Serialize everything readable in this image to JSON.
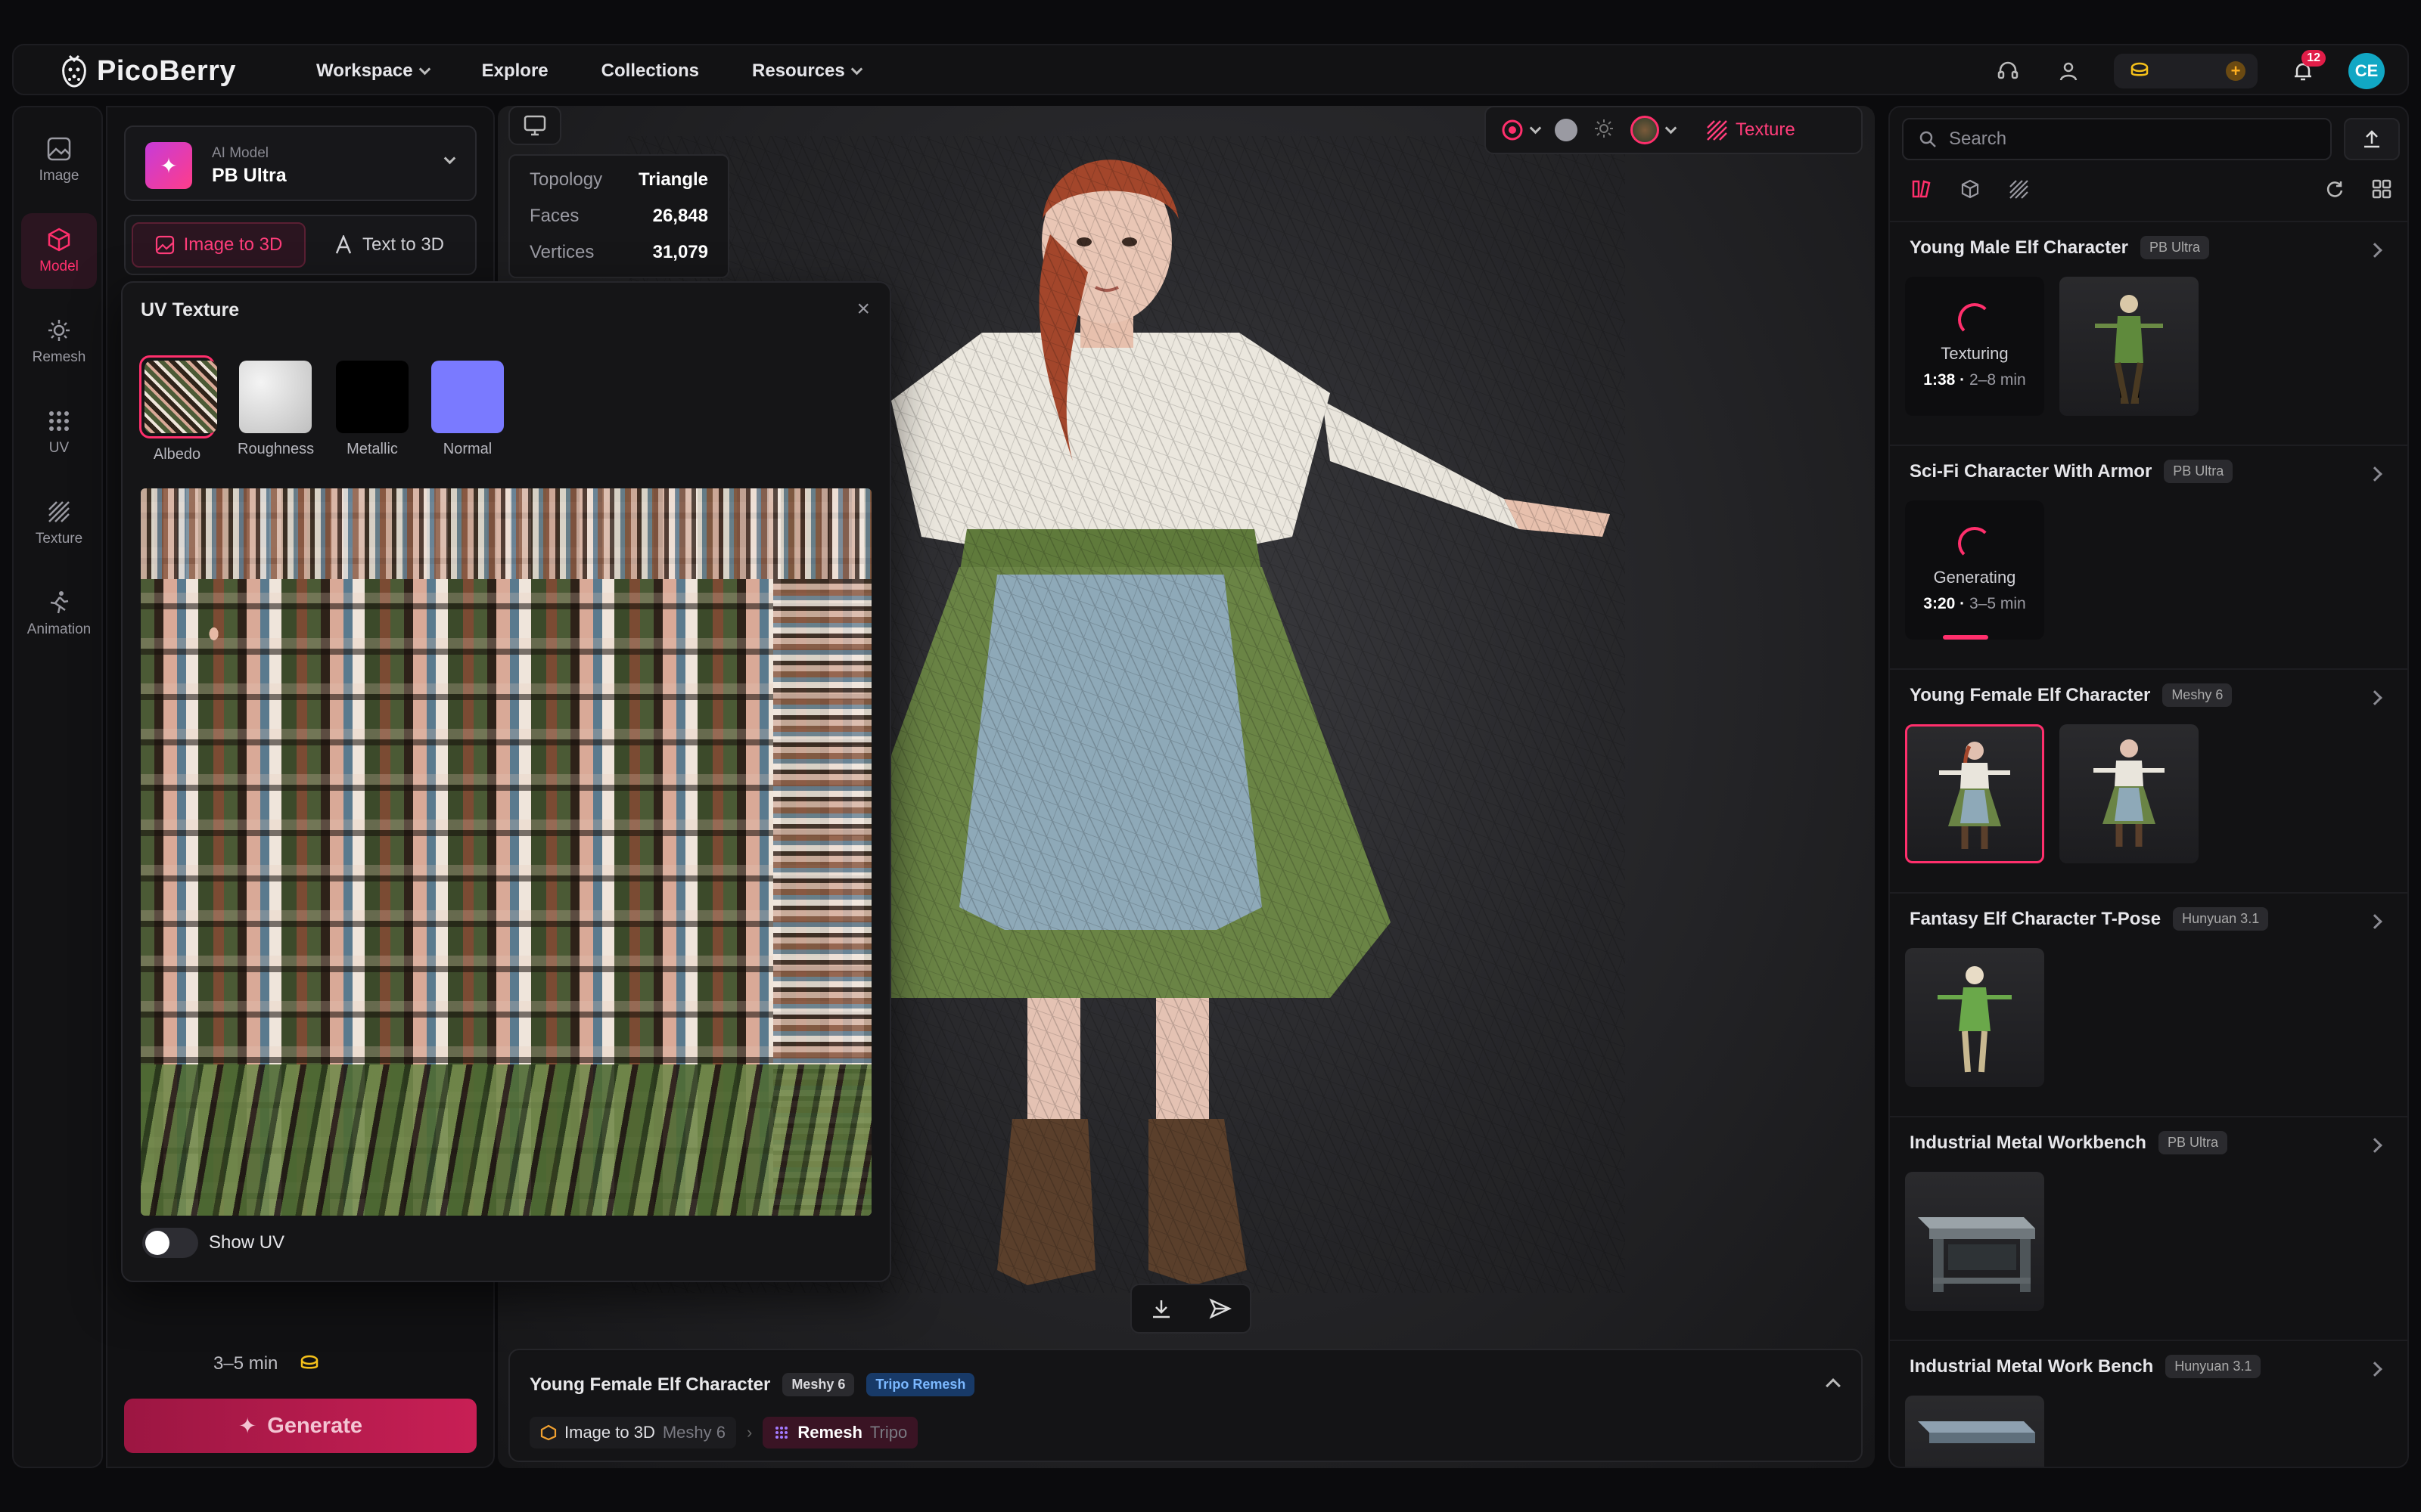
{
  "brand": {
    "name": "PicoBerry"
  },
  "nav": {
    "items": [
      {
        "label": "Workspace",
        "dropdown": true
      },
      {
        "label": "Explore",
        "dropdown": false
      },
      {
        "label": "Collections",
        "dropdown": false
      },
      {
        "label": "Resources",
        "dropdown": true
      }
    ]
  },
  "header": {
    "notification_count": "12",
    "avatar_initials": "CE",
    "icons": [
      "headset-icon",
      "user-icon",
      "coin-icon",
      "plus-icon",
      "bell-icon"
    ]
  },
  "rail": {
    "items": [
      {
        "label": "Image",
        "icon": "image-icon",
        "active": false
      },
      {
        "label": "Model",
        "icon": "cube-icon",
        "active": true
      },
      {
        "label": "Remesh",
        "icon": "remesh-icon",
        "active": false
      },
      {
        "label": "UV",
        "icon": "grid-dots-icon",
        "active": false
      },
      {
        "label": "Texture",
        "icon": "hatch-icon",
        "active": false
      },
      {
        "label": "Animation",
        "icon": "running-icon",
        "active": false
      }
    ]
  },
  "left_panel": {
    "model_caption": "AI Model",
    "model_name": "PB Ultra",
    "tabs": [
      {
        "label": "Image to 3D",
        "active": true
      },
      {
        "label": "Text to 3D",
        "active": false
      }
    ],
    "time_estimate": "3–5 min",
    "generate_label": "Generate"
  },
  "uv_panel": {
    "title": "UV Texture",
    "swatches": [
      {
        "label": "Albedo",
        "color": "#5b5a3c",
        "active": true
      },
      {
        "label": "Roughness",
        "color": "#d9d9d9",
        "active": false
      },
      {
        "label": "Metallic",
        "color": "#000000",
        "active": false
      },
      {
        "label": "Normal",
        "color": "#7a7aff",
        "active": false
      }
    ],
    "show_uv_label": "Show UV",
    "show_uv_on": false
  },
  "viewport": {
    "stats": [
      {
        "key": "Topology",
        "value": "Triangle"
      },
      {
        "key": "Faces",
        "value": "26,848"
      },
      {
        "key": "Vertices",
        "value": "31,079"
      }
    ],
    "texture_label": "Texture",
    "info": {
      "title": "Young Female Elf Character",
      "tags": [
        {
          "label": "Meshy 6",
          "style": "grey"
        },
        {
          "label": "Tripo Remesh",
          "style": "blue"
        }
      ],
      "steps": [
        {
          "label": "Image to 3D",
          "sub": "Meshy 6",
          "active": false
        },
        {
          "label": "Remesh",
          "sub": "Tripo",
          "active": true
        }
      ]
    }
  },
  "right_panel": {
    "search_placeholder": "Search",
    "assets": [
      {
        "title": "Young Male Elf Character",
        "badge": "PB Ultra",
        "status": {
          "text": "Texturing",
          "elapsed": "1:38",
          "estimate": "2–8 min"
        },
        "thumbs": 1
      },
      {
        "title": "Sci-Fi Character With Armor",
        "badge": "PB Ultra",
        "status": {
          "text": "Generating",
          "elapsed": "3:20",
          "estimate": "3–5 min"
        },
        "thumbs": 0
      },
      {
        "title": "Young Female Elf Character",
        "badge": "Meshy 6",
        "status": null,
        "thumbs": 2
      },
      {
        "title": "Fantasy Elf Character T-Pose",
        "badge": "Hunyuan 3.1",
        "status": null,
        "thumbs": 1
      },
      {
        "title": "Industrial Metal Workbench",
        "badge": "PB Ultra",
        "status": null,
        "thumbs": 1
      },
      {
        "title": "Industrial Metal Work Bench",
        "badge": "Hunyuan 3.1",
        "status": null,
        "thumbs": 1
      }
    ]
  },
  "colors": {
    "accent": "#ff2f6c",
    "background": "#0b0b0d",
    "panel": "#121214"
  }
}
